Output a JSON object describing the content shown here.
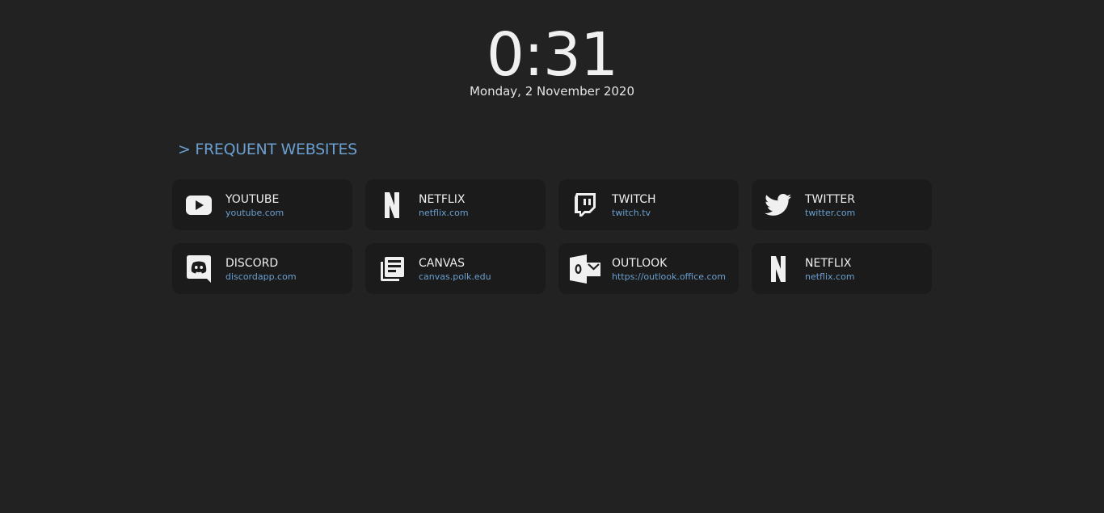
{
  "clock": {
    "time": "0:31",
    "date": "Monday, 2 November 2020"
  },
  "section": {
    "title": "> FREQUENT WEBSITES"
  },
  "colors": {
    "background": "#222222",
    "card": "#1b1b1b",
    "accent": "#6a9fd0",
    "text": "#eeeeee"
  },
  "sites": [
    {
      "name": "YOUTUBE",
      "url": "youtube.com",
      "icon": "youtube-icon"
    },
    {
      "name": "NETFLIX",
      "url": "netflix.com",
      "icon": "netflix-icon"
    },
    {
      "name": "TWITCH",
      "url": "twitch.tv",
      "icon": "twitch-icon"
    },
    {
      "name": "TWITTER",
      "url": "twitter.com",
      "icon": "twitter-icon"
    },
    {
      "name": "DISCORD",
      "url": "discordapp.com",
      "icon": "discord-icon"
    },
    {
      "name": "CANVAS",
      "url": "canvas.polk.edu",
      "icon": "canvas-icon"
    },
    {
      "name": "OUTLOOK",
      "url": "https://outlook.office.com",
      "icon": "outlook-icon"
    },
    {
      "name": "NETFLIX",
      "url": "netflix.com",
      "icon": "netflix-icon"
    }
  ]
}
